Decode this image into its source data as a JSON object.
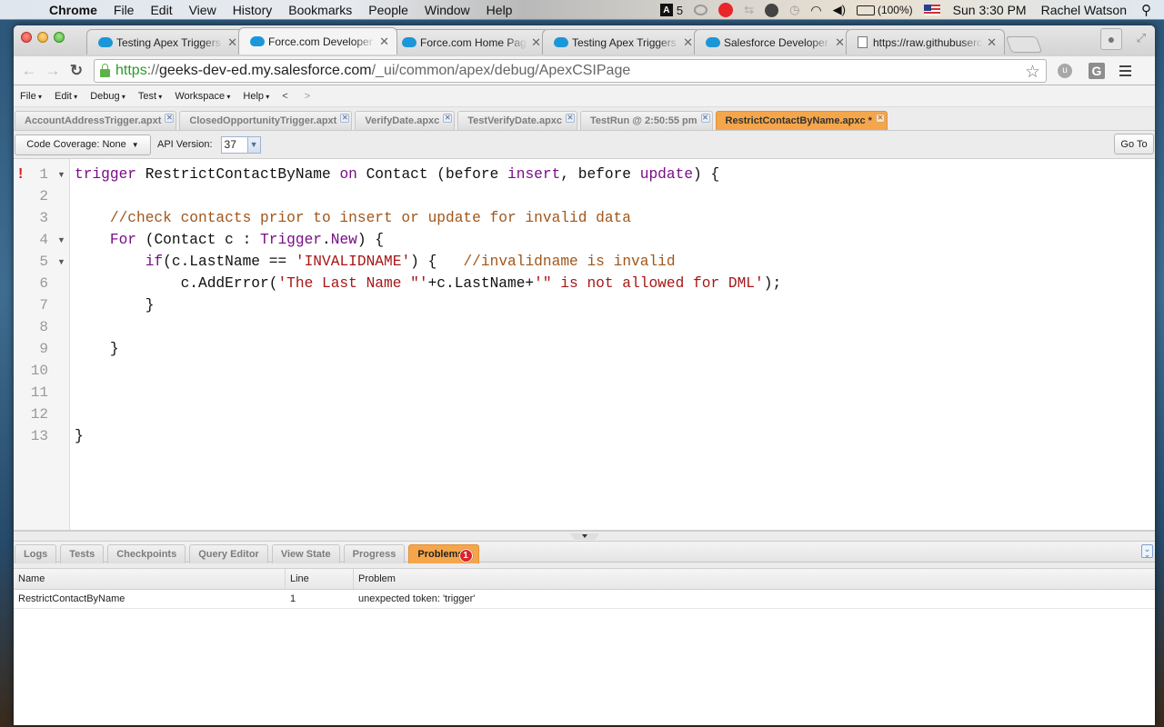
{
  "menubar": {
    "app": "Chrome",
    "items": [
      "File",
      "Edit",
      "View",
      "History",
      "Bookmarks",
      "People",
      "Window",
      "Help"
    ],
    "status": {
      "adobe_count": "5",
      "battery": "(100%)",
      "clock": "Sun 3:30 PM",
      "user": "Rachel Watson"
    }
  },
  "browser": {
    "tabs": [
      {
        "title": "Testing Apex Triggers U",
        "favicon": "salesforce-cloud",
        "active": false
      },
      {
        "title": "Force.com Developer Co",
        "favicon": "salesforce-cloud",
        "active": true
      },
      {
        "title": "Force.com Home Page -",
        "favicon": "salesforce-cloud",
        "active": false
      },
      {
        "title": "Testing Apex Triggers U",
        "favicon": "salesforce-cloud",
        "active": false
      },
      {
        "title": "Salesforce Developer Co",
        "favicon": "salesforce-cloud",
        "active": false
      },
      {
        "title": "https://raw.githubuserc",
        "favicon": "document",
        "active": false
      }
    ],
    "url": {
      "scheme": "https",
      "sep": "://",
      "host": "geeks-dev-ed.my.salesforce.com",
      "path": "/_ui/common/apex/debug/ApexCSIPage"
    },
    "extensions": {
      "u_label": "u",
      "g_label": "G"
    }
  },
  "console": {
    "menu": [
      "File",
      "Edit",
      "Debug",
      "Test",
      "Workspace",
      "Help"
    ],
    "nav_back": "<",
    "nav_forward": ">",
    "file_tabs": [
      {
        "label": "AccountAddressTrigger.apxt",
        "active": false
      },
      {
        "label": "ClosedOpportunityTrigger.apxt",
        "active": false
      },
      {
        "label": "VerifyDate.apxc",
        "active": false
      },
      {
        "label": "TestVerifyDate.apxc",
        "active": false
      },
      {
        "label": "TestRun @ 2:50:55 pm",
        "active": false
      },
      {
        "label": "RestrictContactByName.apxc *",
        "active": true
      }
    ],
    "toolbar": {
      "code_coverage": "Code Coverage: None",
      "api_version_label": "API Version:",
      "api_version": "37",
      "goto": "Go To"
    },
    "editor": {
      "error_marker": "!",
      "error_line": 1,
      "lines": [
        {
          "n": "1",
          "fold": true,
          "tokens": [
            [
              "kw",
              "trigger"
            ],
            [
              "pl",
              " RestrictContactByName "
            ],
            [
              "kw",
              "on"
            ],
            [
              "pl",
              " Contact (before "
            ],
            [
              "kw",
              "insert"
            ],
            [
              "pl",
              ", before "
            ],
            [
              "kw",
              "update"
            ],
            [
              "pl",
              ") {"
            ]
          ]
        },
        {
          "n": "2",
          "fold": false,
          "tokens": []
        },
        {
          "n": "3",
          "fold": false,
          "tokens": [
            [
              "pl",
              "    "
            ],
            [
              "cm",
              "//check contacts prior to insert or update for invalid data"
            ]
          ]
        },
        {
          "n": "4",
          "fold": true,
          "tokens": [
            [
              "pl",
              "    "
            ],
            [
              "kw",
              "For"
            ],
            [
              "pl",
              " (Contact c : "
            ],
            [
              "kw",
              "Trigger"
            ],
            [
              "pl",
              "."
            ],
            [
              "kw",
              "New"
            ],
            [
              "pl",
              ") {"
            ]
          ]
        },
        {
          "n": "5",
          "fold": true,
          "tokens": [
            [
              "pl",
              "        "
            ],
            [
              "kw",
              "if"
            ],
            [
              "pl",
              "(c.LastName == "
            ],
            [
              "str",
              "'INVALIDNAME'"
            ],
            [
              "pl",
              ") {   "
            ],
            [
              "cm",
              "//invalidname is invalid"
            ]
          ]
        },
        {
          "n": "6",
          "fold": false,
          "tokens": [
            [
              "pl",
              "            c.AddError("
            ],
            [
              "str",
              "'The Last Name \"'"
            ],
            [
              "pl",
              "+c.LastName+"
            ],
            [
              "str",
              "'\" is not allowed for DML'"
            ],
            [
              "pl",
              ");"
            ]
          ]
        },
        {
          "n": "7",
          "fold": false,
          "tokens": [
            [
              "pl",
              "        }"
            ]
          ]
        },
        {
          "n": "8",
          "fold": false,
          "tokens": []
        },
        {
          "n": "9",
          "fold": false,
          "tokens": [
            [
              "pl",
              "    }"
            ]
          ]
        },
        {
          "n": "10",
          "fold": false,
          "tokens": []
        },
        {
          "n": "11",
          "fold": false,
          "tokens": []
        },
        {
          "n": "12",
          "fold": false,
          "tokens": []
        },
        {
          "n": "13",
          "fold": false,
          "tokens": [
            [
              "pl",
              "}"
            ]
          ]
        }
      ]
    },
    "bottom_tabs": [
      {
        "label": "Logs",
        "active": false
      },
      {
        "label": "Tests",
        "active": false
      },
      {
        "label": "Checkpoints",
        "active": false
      },
      {
        "label": "Query Editor",
        "active": false
      },
      {
        "label": "View State",
        "active": false
      },
      {
        "label": "Progress",
        "active": false
      },
      {
        "label": "Problems",
        "active": true,
        "badge": "1"
      }
    ],
    "problems": {
      "columns": [
        "Name",
        "Line",
        "Problem"
      ],
      "rows": [
        [
          "RestrictContactByName",
          "1",
          "unexpected token: 'trigger'"
        ]
      ]
    }
  },
  "colors": {
    "active_tab": "#f6a64a",
    "keyword": "#7a0d87",
    "comment": "#a1561a",
    "string": "#a61717",
    "error": "#e01f1f",
    "url_scheme": "#2a9a2a"
  }
}
